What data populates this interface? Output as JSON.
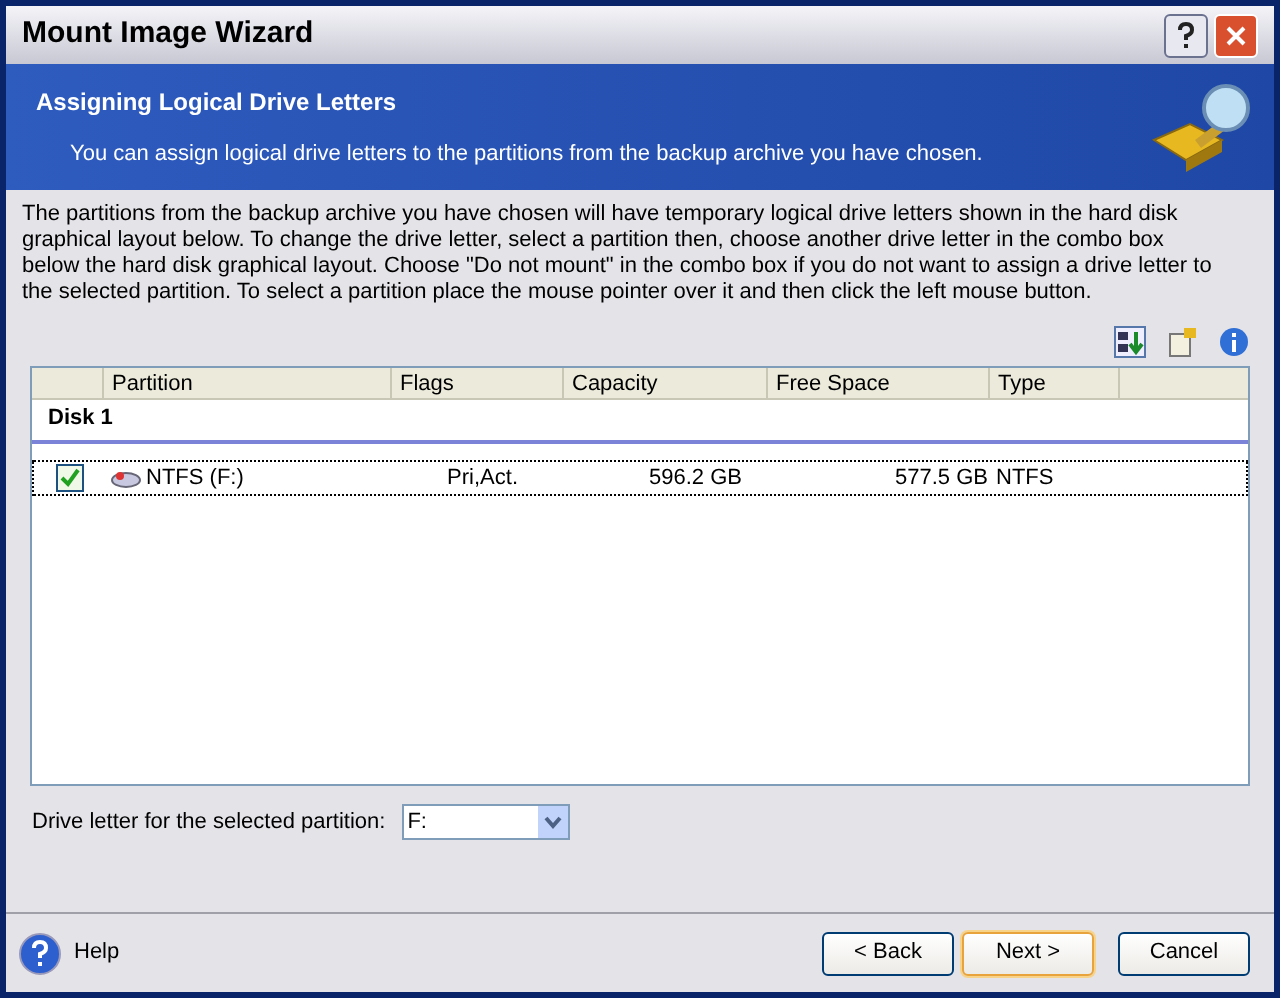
{
  "window": {
    "title": "Mount Image Wizard"
  },
  "header": {
    "title": "Assigning Logical Drive Letters",
    "subtitle": "You can assign logical drive letters to the partitions from the backup archive you have chosen."
  },
  "description": "The partitions from the backup archive you have chosen will have temporary logical drive letters shown in the hard disk graphical layout below. To change the drive letter, select a partition then, choose another drive letter in the combo box below the hard disk graphical layout. Choose \"Do not mount\" in the combo box if you do not want to assign a drive letter to the selected partition. To select a partition place the mouse pointer over it and then click the left mouse button.",
  "table": {
    "columns": [
      "Partition",
      "Flags",
      "Capacity",
      "Free Space",
      "Type"
    ],
    "disk": "Disk 1",
    "rows": [
      {
        "checked": true,
        "selected": true,
        "partition": "NTFS (F:)",
        "flags": "Pri,Act.",
        "capacity": "596.2 GB",
        "free_space": "577.5 GB",
        "type": "NTFS"
      }
    ]
  },
  "drive_letter": {
    "label": "Drive letter for the selected partition:",
    "value": "F:"
  },
  "help": "Help",
  "buttons": [
    {
      "label": "< Back",
      "default": false
    },
    {
      "label": "Next >",
      "default": true
    },
    {
      "label": "Cancel",
      "default": false
    }
  ]
}
